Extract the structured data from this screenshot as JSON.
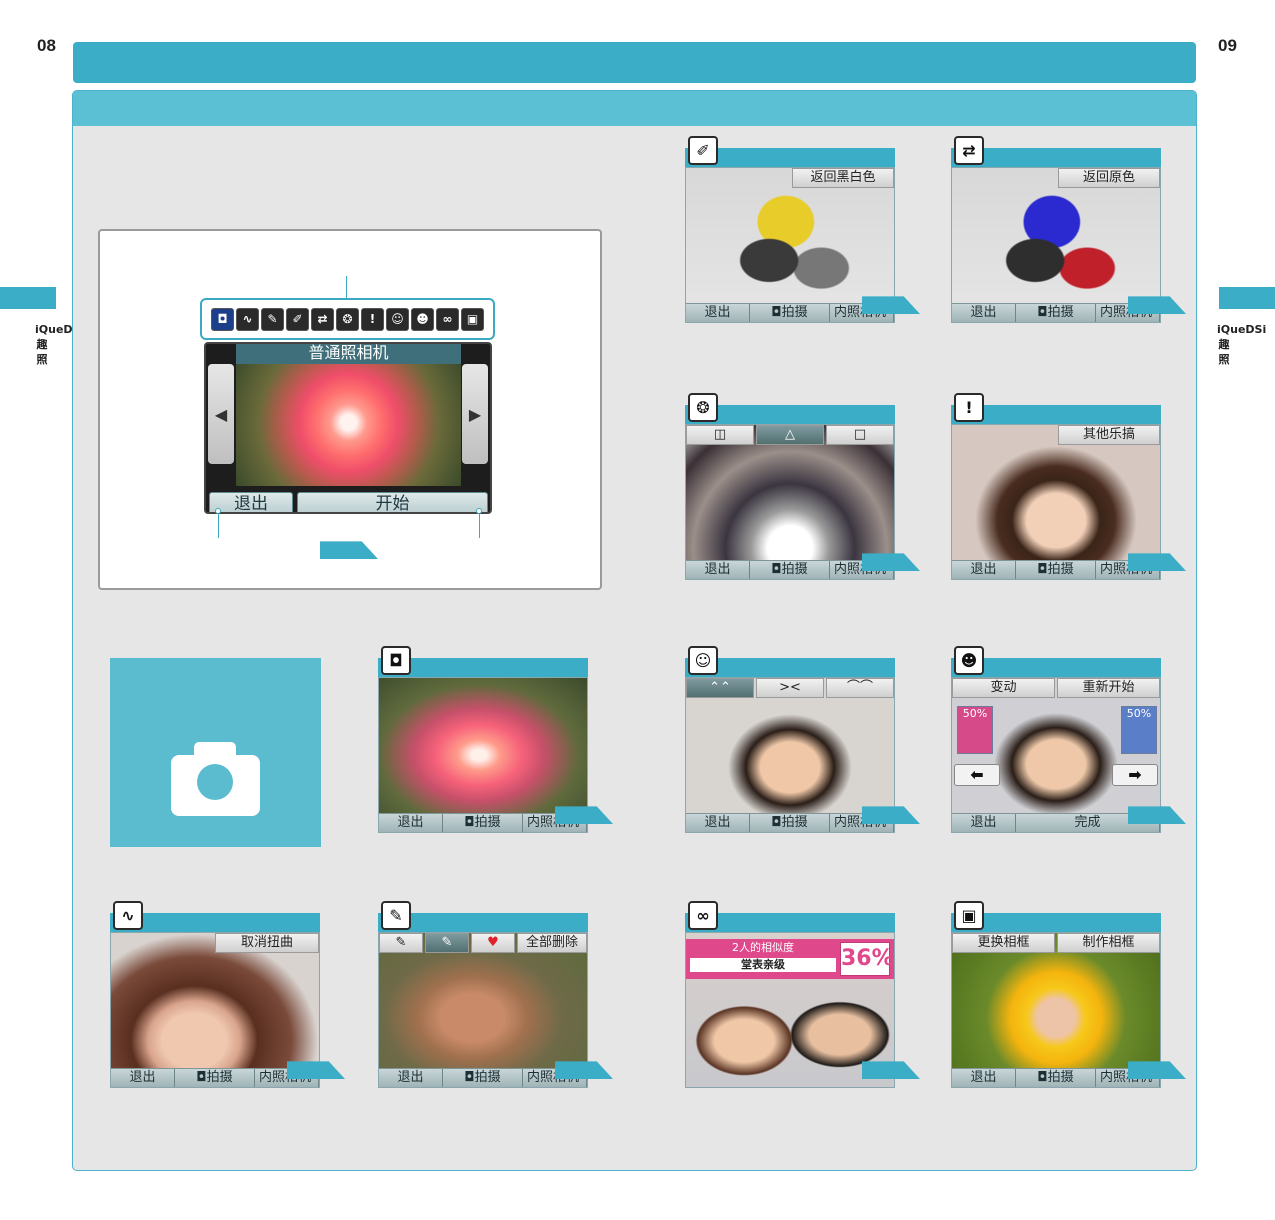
{
  "page": {
    "left_number": "08",
    "right_number": "09",
    "side_label": "iQueDSi趣照"
  },
  "camera_ui": {
    "title": "普通照相机",
    "exit_label": "退出",
    "start_label": "开始",
    "tool_icons": [
      "camera-icon",
      "distort-icon",
      "pen-icon",
      "color-dropper-icon",
      "color-swap-icon",
      "kaleidoscope-icon",
      "exclamation-face-icon",
      "face-icon",
      "morph-face-icon",
      "twin-face-icon",
      "frame-icon"
    ]
  },
  "bottom_bar": {
    "exit": "退出",
    "shoot": "拍摄",
    "inner": "内照相机"
  },
  "cards": {
    "normal": {
      "icon": "camera-icon"
    },
    "distort": {
      "icon": "distort-icon",
      "sub": "取消扭曲"
    },
    "graffiti": {
      "icon": "pen-icon",
      "sub_clear": "全部删除"
    },
    "mono": {
      "icon": "color-dropper-icon",
      "sub": "返回黑白色"
    },
    "swap": {
      "icon": "color-swap-icon",
      "sub": "返回原色"
    },
    "kaleido": {
      "icon": "kaleidoscope-icon",
      "glyphs": [
        "◫",
        "△",
        "□"
      ]
    },
    "prank": {
      "icon": "exclamation-face-icon",
      "sub": "其他乐搞"
    },
    "expression": {
      "icon": "face-icon",
      "faces": [
        "⌃⌃",
        "><",
        "⌒⌒"
      ]
    },
    "morph": {
      "icon": "morph-face-icon",
      "sub_left": "变动",
      "sub_right": "重新开始",
      "pct_left": "50%",
      "pct_right": "50%",
      "done": "完成"
    },
    "similarity": {
      "icon": "twin-face-icon",
      "line1": "2人的相似度",
      "line2": "堂表亲级",
      "percent": "36%"
    },
    "frame": {
      "icon": "frame-icon",
      "sub_left": "更换相框",
      "sub_right": "制作相框"
    }
  },
  "colors": {
    "accent": "#3badc6",
    "panel": "#e6e6e6"
  }
}
